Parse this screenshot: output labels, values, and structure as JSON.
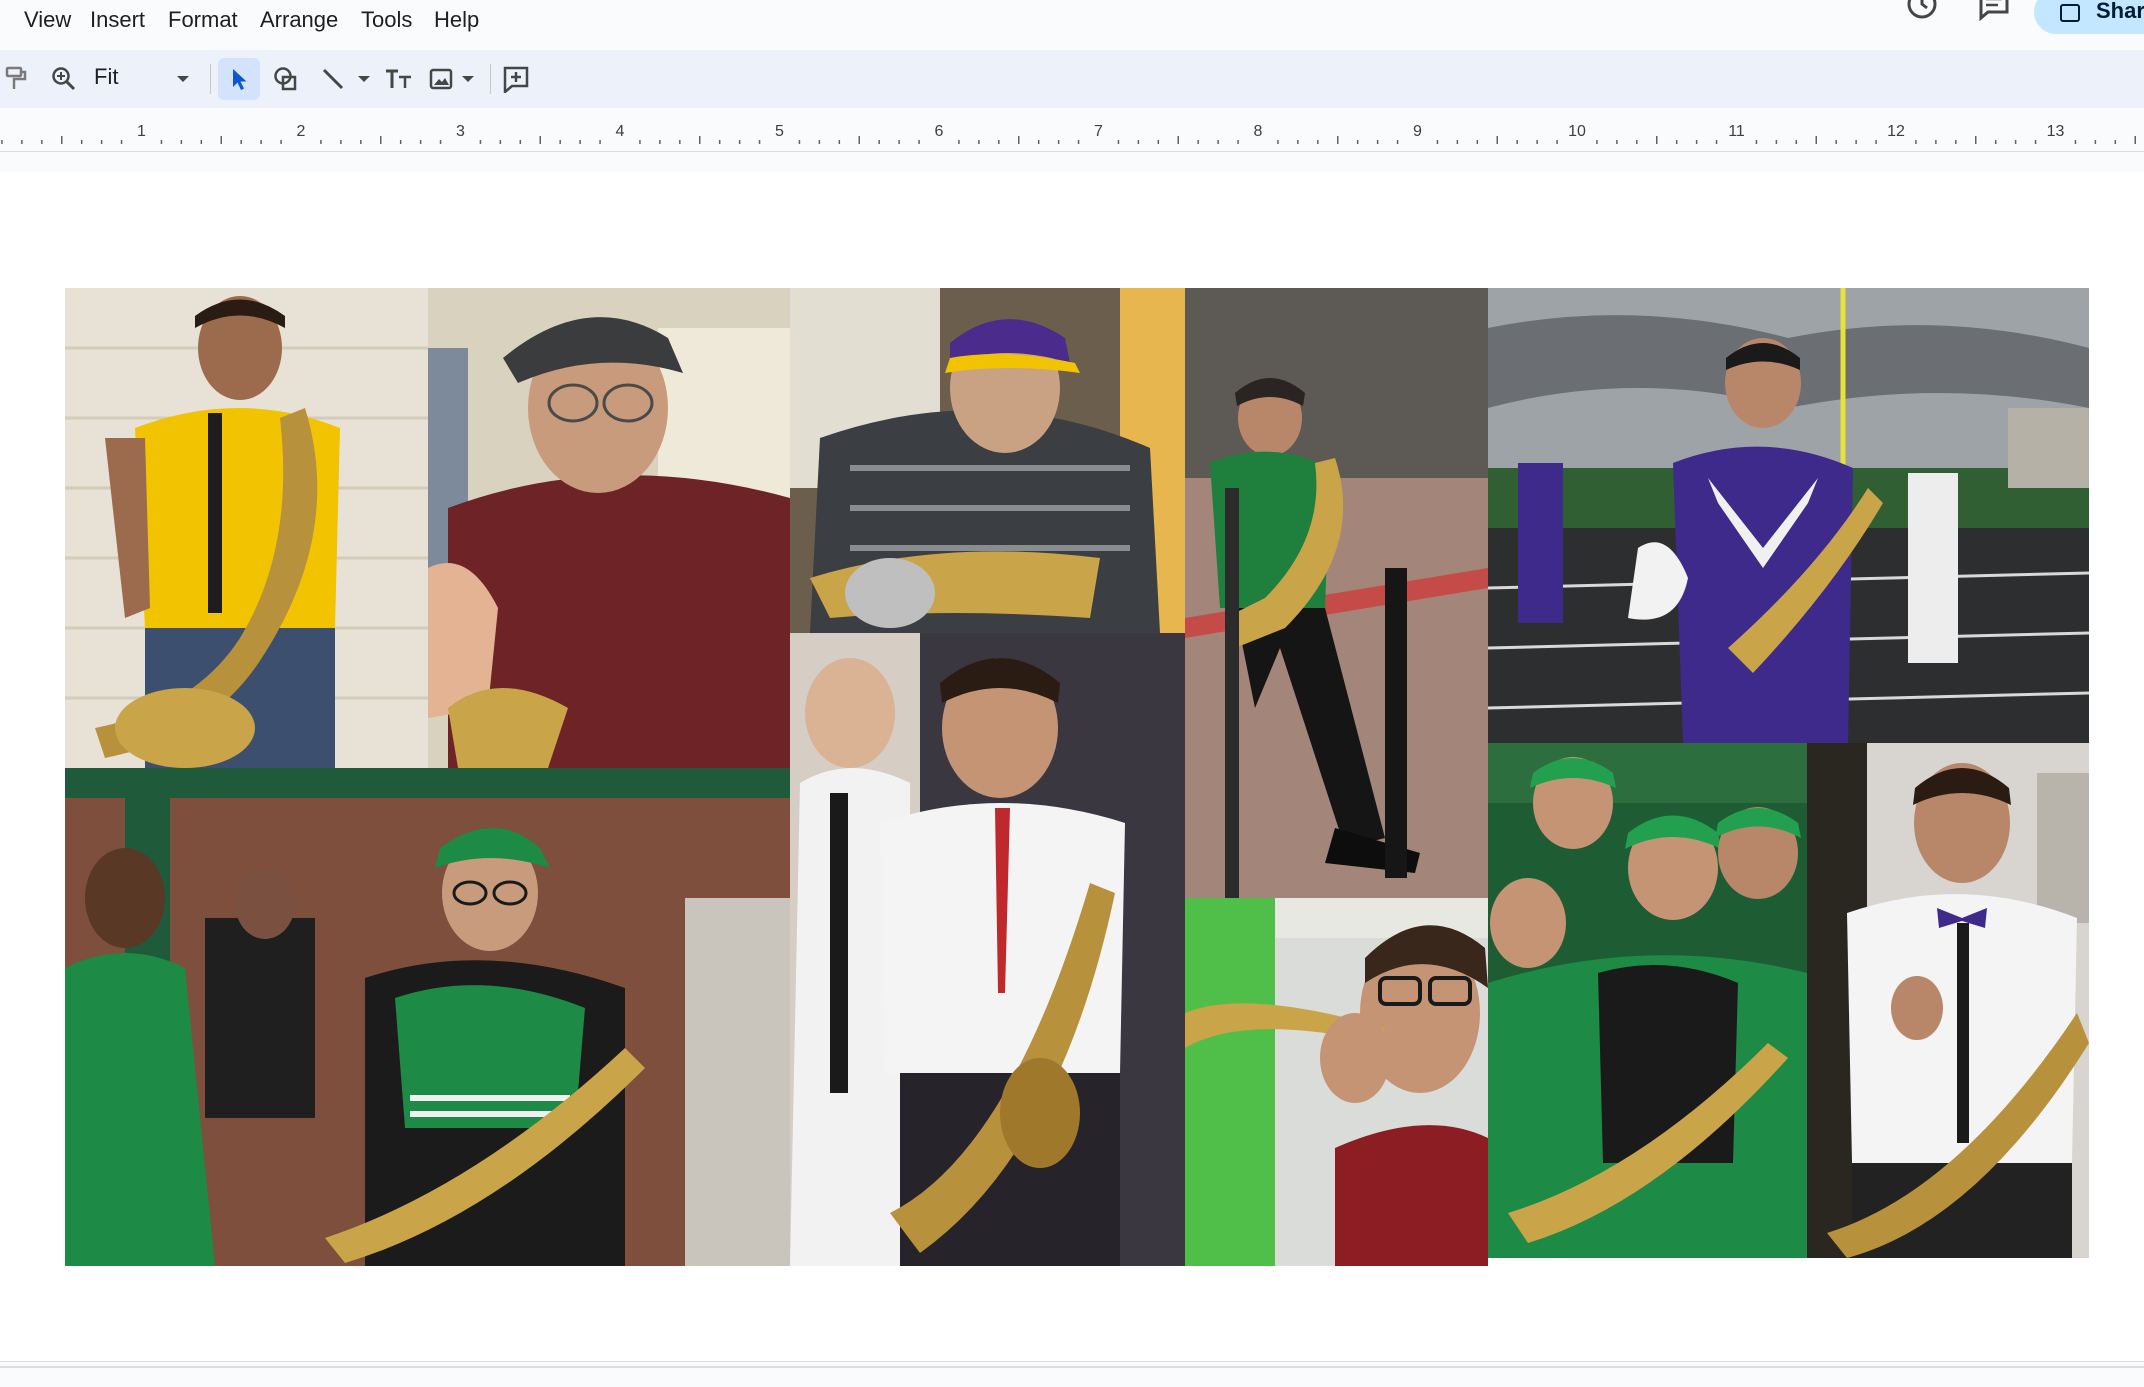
{
  "menu": {
    "items": [
      "View",
      "Insert",
      "Format",
      "Arrange",
      "Tools",
      "Help"
    ]
  },
  "header": {
    "share_label": "Shar"
  },
  "toolbar": {
    "zoom_value": "Fit",
    "icons": [
      "paint-format-icon",
      "zoom-icon",
      "select-icon",
      "shape-icon",
      "line-icon",
      "text-box-icon",
      "image-icon",
      "add-comment-icon"
    ]
  },
  "ruler": {
    "labels": [
      "1",
      "2",
      "3",
      "4",
      "5",
      "6",
      "7",
      "8",
      "9",
      "10",
      "11",
      "12",
      "13"
    ]
  },
  "collage": {
    "photos": [
      "boy in yellow shirt holding tenor saxophone",
      "young man in cap and maroon shirt with saxophone",
      "teen in purple cap playing saxophone",
      "student in green shirt leaning with saxophone",
      "band member in purple uniform on football field",
      "young man in North Texas green uniform with saxophone",
      "school photo of boy with saxophone",
      "young man playing saxophone",
      "group of band members in green caps",
      "boy in white shirt and bow tie giving thumbs up with saxophone"
    ]
  },
  "colors": {
    "toolbar_bg": "#edf2fa",
    "select_active": "#d3e3fd",
    "share_bg": "#c2e7ff",
    "app_bg": "#f9fbfd"
  }
}
